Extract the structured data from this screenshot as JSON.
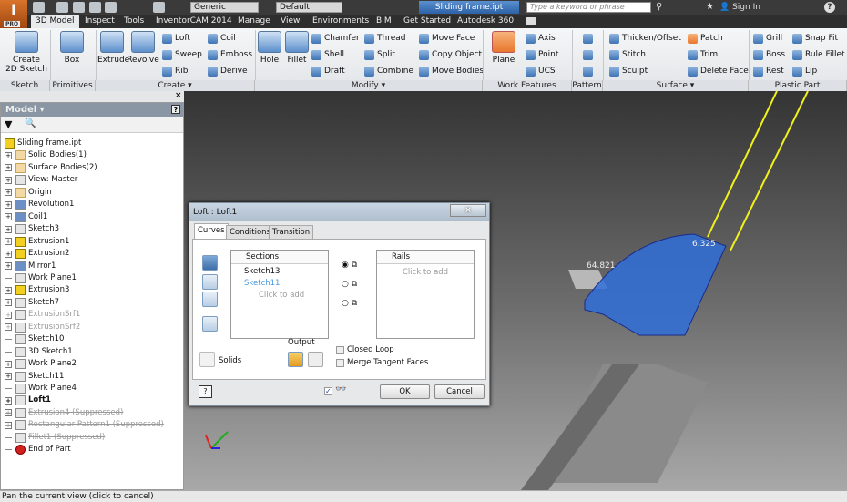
{
  "app": {
    "logo_text": "I",
    "logo_sub": "PRO",
    "document_title": "Sliding frame.ipt"
  },
  "quick_access": {
    "material_combo": "Generic",
    "appearance_combo": "Default",
    "search_placeholder": "Type a keyword or phrase",
    "sign_in": "Sign In",
    "help": "?"
  },
  "tabs": [
    {
      "label": "3D Model",
      "active": true
    },
    {
      "label": "Inspect"
    },
    {
      "label": "Tools"
    },
    {
      "label": "InventorCAM 2014"
    },
    {
      "label": "Manage"
    },
    {
      "label": "View"
    },
    {
      "label": "Environments"
    },
    {
      "label": "BIM"
    },
    {
      "label": "Get Started"
    },
    {
      "label": "Autodesk 360"
    }
  ],
  "ribbon": {
    "big_tools": [
      {
        "label": "Create\n2D Sketch",
        "icon": "sketch-icon"
      },
      {
        "label": "Box",
        "icon": "box-icon"
      },
      {
        "label": "Extrude",
        "icon": "extrude-icon"
      },
      {
        "label": "Revolve",
        "icon": "revolve-icon"
      },
      {
        "label": "Hole",
        "icon": "hole-icon"
      },
      {
        "label": "Fillet",
        "icon": "fillet-icon"
      },
      {
        "label": "Plane",
        "icon": "plane-icon"
      }
    ],
    "small_tools": [
      [
        "Loft",
        "Sweep",
        "Rib"
      ],
      [
        "Coil",
        "Emboss",
        "Derive"
      ],
      [
        "Chamfer",
        "Shell",
        "Draft"
      ],
      [
        "Thread",
        "Split",
        "Combine"
      ],
      [
        "Move Face",
        "Copy Object",
        "Move Bodies"
      ],
      [
        "Axis",
        "Point",
        "UCS"
      ],
      [
        "",
        "",
        ""
      ],
      [
        "Thicken/Offset",
        "Stitch",
        "Sculpt"
      ],
      [
        "Patch",
        "Trim",
        "Delete Face"
      ],
      [
        "Grill",
        "Boss",
        "Rest"
      ],
      [
        "Snap Fit",
        "Rule Fillet",
        "Lip"
      ]
    ],
    "panels": [
      "Sketch",
      "Primitives",
      "Create ▾",
      "Modify ▾",
      "Work Features",
      "Pattern",
      "Surface ▾",
      "Plastic Part"
    ]
  },
  "browser": {
    "title": "Model ▾",
    "items": [
      {
        "label": "Sliding frame.ipt",
        "icon": "part",
        "expand": false,
        "root": true
      },
      {
        "label": "Solid Bodies(1)",
        "icon": "fold",
        "expand": true
      },
      {
        "label": "Surface Bodies(2)",
        "icon": "fold",
        "expand": true
      },
      {
        "label": "View: Master",
        "icon": "view",
        "expand": true
      },
      {
        "label": "Origin",
        "icon": "fold",
        "expand": true
      },
      {
        "label": "Revolution1",
        "icon": "blue",
        "expand": true
      },
      {
        "label": "Coil1",
        "icon": "blue",
        "expand": true
      },
      {
        "label": "Sketch3",
        "icon": "sketch",
        "expand": true
      },
      {
        "label": "Extrusion1",
        "icon": "ext",
        "expand": true
      },
      {
        "label": "Extrusion2",
        "icon": "ext",
        "expand": true
      },
      {
        "label": "Mirror1",
        "icon": "blue",
        "expand": true
      },
      {
        "label": "Work Plane1",
        "icon": "plane",
        "expand": false
      },
      {
        "label": "Extrusion3",
        "icon": "ext",
        "expand": true
      },
      {
        "label": "Sketch7",
        "icon": "sketch",
        "expand": true
      },
      {
        "label": "ExtrusionSrf1",
        "icon": "plane",
        "expand": true,
        "state": "grey"
      },
      {
        "label": "ExtrusionSrf2",
        "icon": "plane",
        "expand": true,
        "state": "grey"
      },
      {
        "label": "Sketch10",
        "icon": "sketch",
        "expand": false
      },
      {
        "label": "3D Sketch1",
        "icon": "sketch",
        "expand": false
      },
      {
        "label": "Work Plane2",
        "icon": "plane",
        "expand": true
      },
      {
        "label": "Sketch11",
        "icon": "sketch",
        "expand": true
      },
      {
        "label": "Work Plane4",
        "icon": "plane",
        "expand": false
      },
      {
        "label": "Loft1",
        "icon": "sketch",
        "expand": true,
        "state": "bold"
      },
      {
        "label": "Extrusion4 (Suppressed)",
        "icon": "plane",
        "expand": true,
        "state": "supp"
      },
      {
        "label": "Rectangular Pattern1 (Suppressed)",
        "icon": "plane",
        "expand": true,
        "state": "supp"
      },
      {
        "label": "Fillet1 (Suppressed)",
        "icon": "plane",
        "expand": false,
        "state": "supp"
      },
      {
        "label": "End of Part",
        "icon": "end",
        "expand": false
      }
    ]
  },
  "dialog": {
    "title": "Loft : Loft1",
    "tabs": [
      "Curves",
      "Conditions",
      "Transition"
    ],
    "sections_header": "Sections",
    "sections": [
      "Sketch13",
      "Sketch11"
    ],
    "sections_add": "Click to add",
    "rails_header": "Rails",
    "rails_add": "Click to add",
    "output_label": "Output",
    "solids_label": "Solids",
    "closed_loop": "Closed Loop",
    "merge_tangent": "Merge Tangent Faces",
    "ok": "OK",
    "cancel": "Cancel",
    "preview_checked": true
  },
  "viewport": {
    "dim1": "64.821",
    "dim2": "6.325",
    "accent": "#2f6fd8",
    "rail_color": "#f2f21a"
  },
  "status": "Pan the current view (click to cancel)"
}
